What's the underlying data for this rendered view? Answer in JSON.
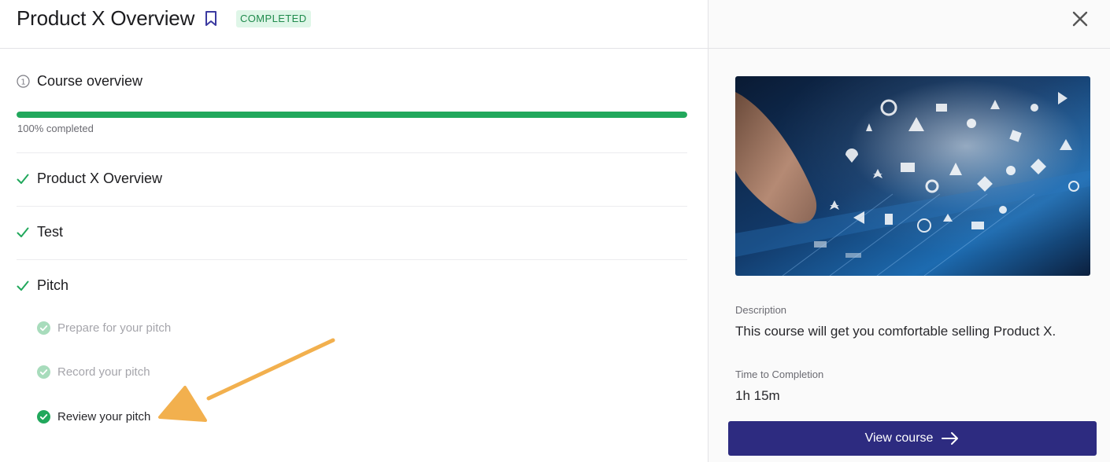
{
  "header": {
    "title": "Product X Overview",
    "status_badge": "COMPLETED"
  },
  "overview": {
    "label": "Course overview",
    "progress_percent": 100,
    "progress_text": "100% completed"
  },
  "sections": [
    {
      "label": "Product X Overview",
      "completed": true
    },
    {
      "label": "Test",
      "completed": true
    },
    {
      "label": "Pitch",
      "completed": true
    }
  ],
  "pitch_steps": [
    {
      "label": "Prepare for your pitch",
      "state": "completed-faded"
    },
    {
      "label": "Record your pitch",
      "state": "completed-faded"
    },
    {
      "label": "Review your pitch",
      "state": "completed-active"
    }
  ],
  "details": {
    "description_label": "Description",
    "description_text": "This course will get you comfortable selling Product X.",
    "time_label": "Time to Completion",
    "time_value": "1h 15m",
    "view_button": "View course"
  },
  "colors": {
    "accent_green": "#21a85c",
    "button_navy": "#2d2b80",
    "annotation_arrow": "#f2b04e"
  },
  "icons": [
    "bookmark-icon",
    "close-icon",
    "info-icon",
    "check-icon",
    "check-circle-icon",
    "arrow-right-icon"
  ]
}
